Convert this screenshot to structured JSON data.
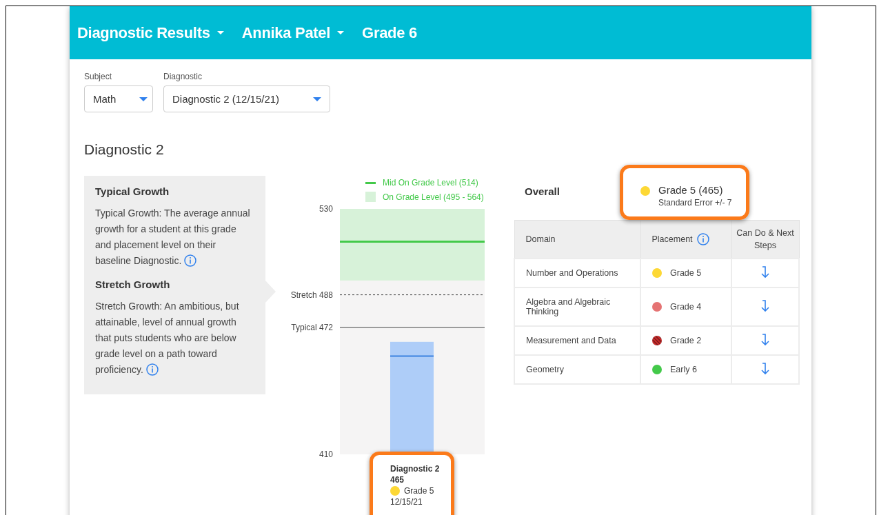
{
  "header": {
    "items": [
      {
        "label": "Diagnostic Results",
        "dropdown": true
      },
      {
        "label": "Annika Patel",
        "dropdown": true
      },
      {
        "label": "Grade 6",
        "dropdown": false
      }
    ]
  },
  "filters": [
    {
      "label": "Subject",
      "value": "Math"
    },
    {
      "label": "Diagnostic",
      "value": "Diagnostic 2 (12/15/21)"
    }
  ],
  "title": "Diagnostic 2",
  "growth_info": [
    {
      "heading": "Typical Growth",
      "text": "Typical Growth: The average annual growth for a student at this grade and placement level on their baseline Diagnostic."
    },
    {
      "heading": "Stretch Growth",
      "text": "Stretch Growth: An ambitious, but attainable, level of annual growth that puts students who are below grade level on a path toward proficiency."
    }
  ],
  "chart": {
    "chart_data": {
      "type": "bar",
      "values": [
        465
      ],
      "ylim": [
        410,
        530
      ],
      "legend": "upper right",
      "yticks": [
        410,
        530
      ],
      "ref_lines": [
        {
          "axis": "y",
          "value": 514,
          "label": "Mid On Grade Level (514)",
          "color": "#43c94a"
        },
        {
          "axis": "y",
          "value": 488,
          "label": "Stretch 488",
          "color": "#444444"
        },
        {
          "axis": "y",
          "value": 472,
          "label": "Typical 472",
          "color": "#444444"
        },
        {
          "axis": "y",
          "value": 458,
          "color": "#3b82e0"
        }
      ],
      "bands": [
        {
          "axis": "y",
          "from": 495,
          "to": 564,
          "label": "On Grade Level (495 - 564)",
          "color": "#d7f2d9"
        }
      ]
    },
    "bar_label": {
      "title": "Diagnostic 2",
      "score": "465",
      "placement": "Grade 5",
      "color": "#fdd835",
      "date": "12/15/21"
    }
  },
  "overall": {
    "label": "Overall",
    "placement": "Grade 5 (465)",
    "color": "#fdd835",
    "standard_error": "Standard Error +/- 7"
  },
  "domain_table": {
    "columns": [
      "Domain",
      "Placement",
      "Can Do & Next Steps"
    ],
    "rows": [
      {
        "domain": "Number and Operations",
        "placement": "Grade 5",
        "color": "#fdd835",
        "striped": false
      },
      {
        "domain": "Algebra and Algebraic Thinking",
        "placement": "Grade 4",
        "color": "#e57373",
        "striped": false
      },
      {
        "domain": "Measurement and Data",
        "placement": "Grade 2",
        "color": "#c62828",
        "striped": true
      },
      {
        "domain": "Geometry",
        "placement": "Early 6",
        "color": "#43c94a",
        "striped": false
      }
    ]
  }
}
